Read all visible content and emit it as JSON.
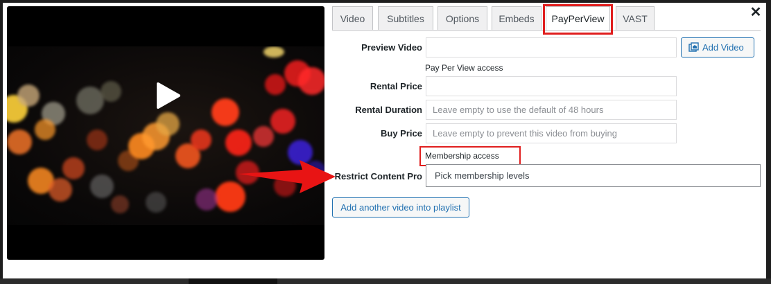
{
  "tabs": [
    {
      "label": "Video"
    },
    {
      "label": "Subtitles"
    },
    {
      "label": "Options"
    },
    {
      "label": "Embeds"
    },
    {
      "label": "PayPerView"
    },
    {
      "label": "VAST"
    }
  ],
  "active_tab": "PayPerView",
  "form": {
    "preview_video": {
      "label": "Preview Video",
      "value": ""
    },
    "add_video_label": "Add Video",
    "ppv_section": "Pay Per View access",
    "rental_price": {
      "label": "Rental Price",
      "value": ""
    },
    "rental_duration": {
      "label": "Rental Duration",
      "placeholder": "Leave empty to use the default of 48 hours"
    },
    "buy_price": {
      "label": "Buy Price",
      "placeholder": "Leave empty to prevent this video from buying"
    },
    "membership_section": "Membership access",
    "restrict_content_pro": {
      "label": "Restrict Content Pro",
      "value": "Pick membership levels"
    },
    "add_playlist_label": "Add another video into playlist"
  },
  "colors": {
    "highlight": "#e01e1e",
    "link": "#2271b1"
  },
  "icons": [
    "play-icon",
    "close-icon",
    "add-media-icon",
    "arrow-annotation-icon"
  ]
}
